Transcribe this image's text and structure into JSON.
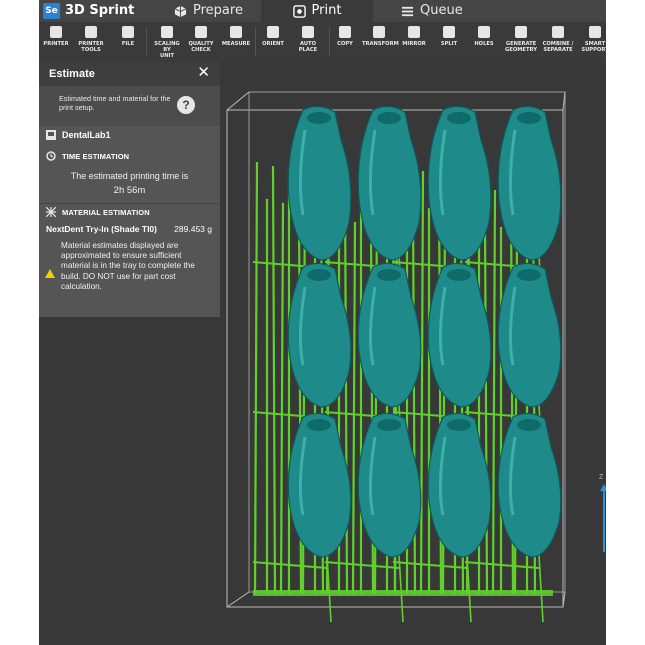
{
  "app": {
    "logo_text": "Se",
    "name": "3D Sprint"
  },
  "tabs": [
    {
      "label": "Prepare",
      "icon": "cube-icon",
      "active": false
    },
    {
      "label": "Print",
      "icon": "print-icon",
      "active": true
    },
    {
      "label": "Queue",
      "icon": "list-icon",
      "active": false
    }
  ],
  "toolbar": [
    {
      "label": "PRINTER",
      "icon": "printer-icon"
    },
    {
      "label": "PRINTER\nTOOLS",
      "icon": "printer-tools-icon"
    },
    {
      "label": "FILE",
      "icon": "file-icon"
    },
    {
      "label": "SCALING BY\nUNIT",
      "icon": "scale-icon"
    },
    {
      "label": "QUALITY\nCHECK",
      "icon": "check-icon"
    },
    {
      "label": "MEASURE",
      "icon": "measure-icon"
    },
    {
      "label": "ORIENT",
      "icon": "orient-icon"
    },
    {
      "label": "AUTO PLACE",
      "icon": "auto-place-icon"
    },
    {
      "label": "COPY",
      "icon": "copy-icon"
    },
    {
      "label": "TRANSFORM",
      "icon": "transform-icon"
    },
    {
      "label": "MIRROR",
      "icon": "mirror-icon"
    },
    {
      "label": "SPLIT",
      "icon": "split-icon"
    },
    {
      "label": "HOLES",
      "icon": "holes-icon"
    },
    {
      "label": "GENERATE\nGEOMETRY",
      "icon": "geometry-icon"
    },
    {
      "label": "COMBINE /\nSEPARATE",
      "icon": "combine-icon"
    },
    {
      "label": "SMART\nSUPPORT",
      "icon": "support-icon"
    }
  ],
  "estimate": {
    "title": "Estimate",
    "close": "✕",
    "info": "Estimated time and material for the print setup.",
    "help": "?",
    "printer": "DentalLab1",
    "time_label": "TIME ESTIMATION",
    "time_text": "The estimated printing time is",
    "time_value": "2h  56m",
    "material_label": "MATERIAL ESTIMATION",
    "material_name": "NextDent Try-In (Shade TI0)",
    "material_amount": "289.453 g",
    "warning": "Material estimates displayed are approximated to ensure sufficient material is in the tray to complete the build. DO NOT use for part cost calculation."
  },
  "colors": {
    "accent": "#2b7fd6",
    "model": "#1f8a8a",
    "support": "#5fd12a",
    "warning": "#f0d000"
  },
  "viewport": {
    "axis_label": "Z"
  }
}
